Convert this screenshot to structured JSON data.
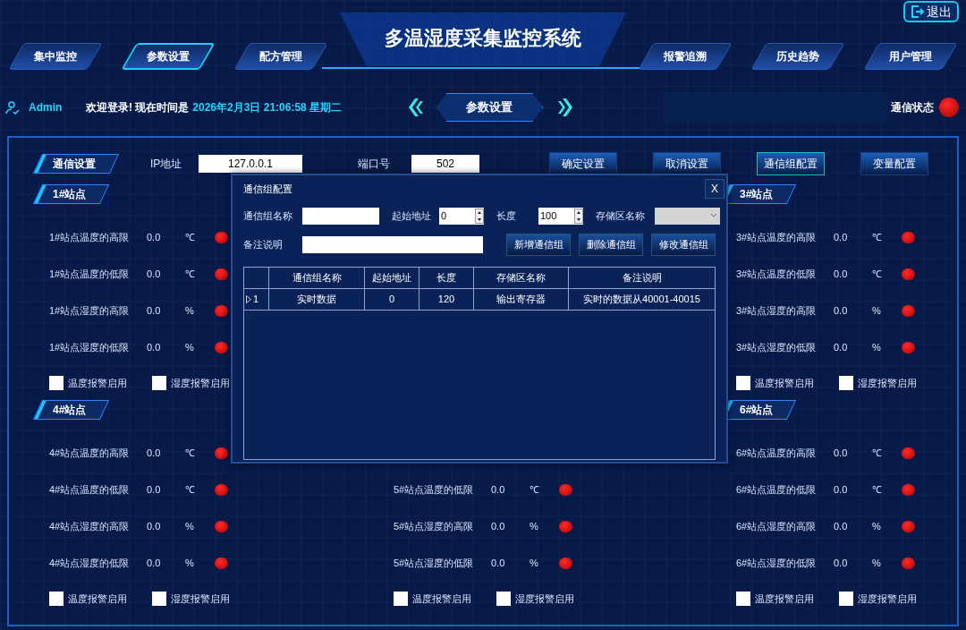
{
  "header": {
    "title": "多温湿度采集监控系统",
    "exit_button": "退出"
  },
  "nav_tabs": [
    {
      "label": "集中监控",
      "selected": false
    },
    {
      "label": "参数设置",
      "selected": true
    },
    {
      "label": "配方管理",
      "selected": false
    },
    {
      "label": "报警追溯",
      "selected": false
    },
    {
      "label": "历史趋势",
      "selected": false
    },
    {
      "label": "用户管理",
      "selected": false
    }
  ],
  "info_bar": {
    "user": "Admin",
    "welcome": "欢迎登录! 现在时间是",
    "datetime": "2026年2月3日 21:06:58 星期二",
    "page_label": "参数设置",
    "status_label": "通信状态",
    "status_alarm": true
  },
  "comm_settings": {
    "title": "通信设置",
    "ip_label": "IP地址",
    "ip_value": "127.0.0.1",
    "port_label": "端口号",
    "port_value": "502",
    "buttons": [
      {
        "label": "确定设置",
        "selected": false
      },
      {
        "label": "取消设置",
        "selected": false
      },
      {
        "label": "通信组配置",
        "selected": true
      },
      {
        "label": "变量配置",
        "selected": false
      }
    ]
  },
  "station_grid": [
    {
      "left": {
        "title": "1#站点",
        "rows": [
          {
            "label": "1#站点温度的高限",
            "value": "0.0",
            "unit": "℃",
            "alarm": true
          },
          {
            "label": "1#站点温度的低限",
            "value": "0.0",
            "unit": "℃",
            "alarm": true
          },
          {
            "label": "1#站点湿度的高限",
            "value": "0.0",
            "unit": "%",
            "alarm": true
          },
          {
            "label": "1#站点湿度的低限",
            "value": "0.0",
            "unit": "%",
            "alarm": true
          }
        ],
        "checkboxes": [
          {
            "label": "温度报警启用",
            "checked": false
          },
          {
            "label": "湿度报警启用",
            "checked": false
          }
        ]
      },
      "right": {
        "title": "3#站点",
        "rows": [
          {
            "label": "3#站点温度的高限",
            "value": "0.0",
            "unit": "℃",
            "alarm": true
          },
          {
            "label": "3#站点温度的低限",
            "value": "0.0",
            "unit": "℃",
            "alarm": true
          },
          {
            "label": "3#站点湿度的高限",
            "value": "0.0",
            "unit": "%",
            "alarm": true
          },
          {
            "label": "3#站点湿度的低限",
            "value": "0.0",
            "unit": "%",
            "alarm": true
          }
        ],
        "checkboxes": [
          {
            "label": "温度报警启用",
            "checked": false
          },
          {
            "label": "湿度报警启用",
            "checked": false
          }
        ]
      }
    },
    {
      "left": {
        "title": "4#站点",
        "rows": [
          {
            "label": "4#站点温度的高限",
            "value": "0.0",
            "unit": "℃",
            "alarm": true
          },
          {
            "label": "4#站点温度的低限",
            "value": "0.0",
            "unit": "℃",
            "alarm": true
          },
          {
            "label": "4#站点湿度的高限",
            "value": "0.0",
            "unit": "%",
            "alarm": true
          },
          {
            "label": "4#站点湿度的低限",
            "value": "0.0",
            "unit": "%",
            "alarm": true
          }
        ],
        "checkboxes": [
          {
            "label": "温度报警启用",
            "checked": false
          },
          {
            "label": "湿度报警启用",
            "checked": false
          }
        ]
      },
      "middle": {
        "rows": [
          {
            "label": "5#站点温度的低限",
            "value": "0.0",
            "unit": "℃",
            "alarm": true
          },
          {
            "label": "5#站点湿度的高限",
            "value": "0.0",
            "unit": "%",
            "alarm": true
          },
          {
            "label": "5#站点湿度的低限",
            "value": "0.0",
            "unit": "%",
            "alarm": true
          }
        ],
        "checkboxes": [
          {
            "label": "温度报警启用",
            "checked": false
          },
          {
            "label": "湿度报警启用",
            "checked": false
          }
        ]
      },
      "right": {
        "title": "6#站点",
        "rows": [
          {
            "label": "6#站点温度的高限",
            "value": "0.0",
            "unit": "℃",
            "alarm": true
          },
          {
            "label": "6#站点温度的低限",
            "value": "0.0",
            "unit": "℃",
            "alarm": true
          },
          {
            "label": "6#站点湿度的高限",
            "value": "0.0",
            "unit": "%",
            "alarm": true
          },
          {
            "label": "6#站点湿度的低限",
            "value": "0.0",
            "unit": "%",
            "alarm": true
          }
        ],
        "checkboxes": [
          {
            "label": "温度报警启用",
            "checked": false
          },
          {
            "label": "湿度报警启用",
            "checked": false
          }
        ]
      }
    }
  ],
  "dialog": {
    "title": "通信组配置",
    "close": "X",
    "fields": [
      {
        "kind": "text",
        "label": "通信组名称"
      },
      {
        "kind": "spin",
        "label": "起始地址",
        "value": "0"
      },
      {
        "kind": "spin",
        "label": "长度",
        "value": "100"
      },
      {
        "kind": "select",
        "label": "存储区名称",
        "disabled": true
      }
    ],
    "remark": {
      "label": "备注说明"
    },
    "buttons": [
      "新增通信组",
      "删除通信组",
      "修改通信组"
    ],
    "table": {
      "columns": [
        "通信组名称",
        "起始地址",
        "长度",
        "存储区名称",
        "备注说明"
      ],
      "rows": [
        {
          "current": true,
          "index": "1",
          "cells": [
            "实时数据",
            "0",
            "120",
            "输出寄存器",
            "实时的数据从40001-40015"
          ]
        }
      ]
    }
  }
}
